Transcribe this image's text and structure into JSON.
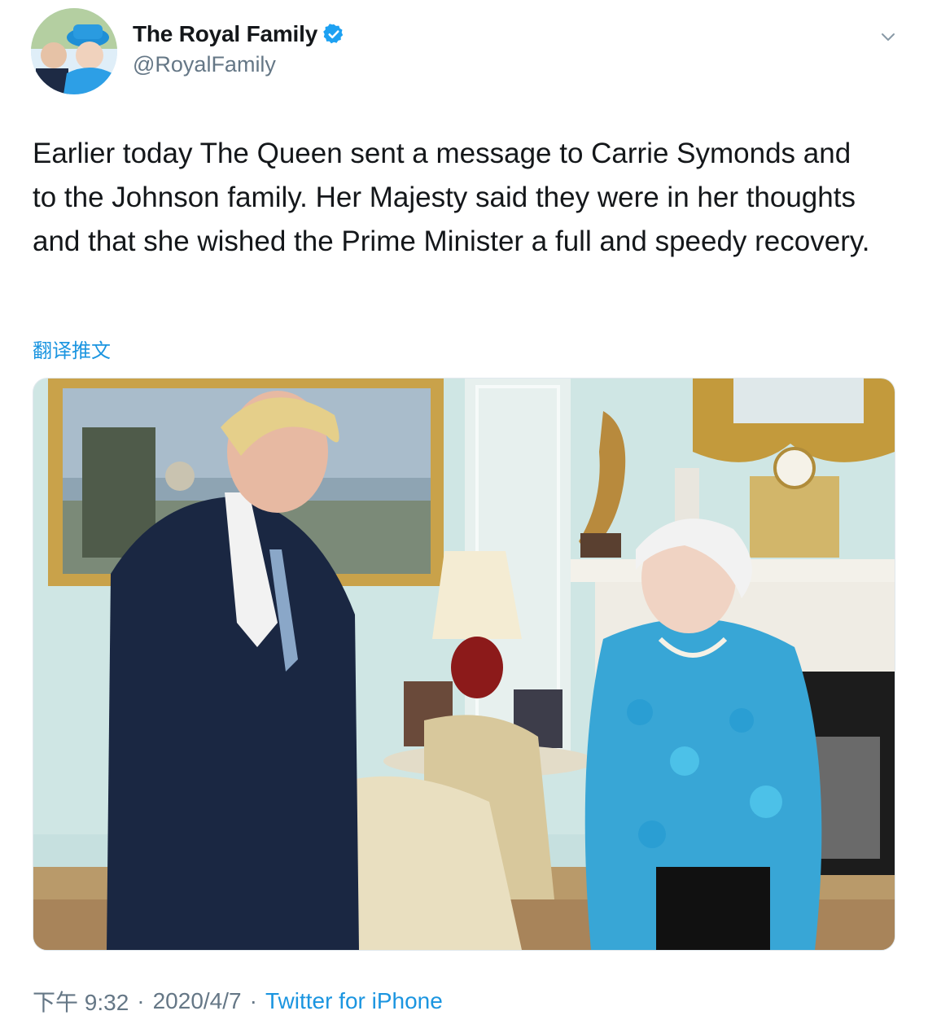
{
  "tweet": {
    "display_name": "The Royal Family",
    "handle": "@RoyalFamily",
    "verified": true,
    "text": "Earlier today The Queen sent a message to Carrie Symonds and to the Johnson family. Her Majesty said they were in her thoughts and that she wished the Prime Minister a full and speedy recovery.",
    "translate_label": "翻译推文",
    "time": "下午 9:32",
    "date": "2020/4/7",
    "separator": "·",
    "source": "Twitter for iPhone"
  },
  "icons": {
    "verified": "verified-badge-icon",
    "menu": "chevron-down-icon"
  },
  "colors": {
    "link": "#1b95e0",
    "secondary_text": "#657786",
    "verified": "#1da1f2"
  }
}
